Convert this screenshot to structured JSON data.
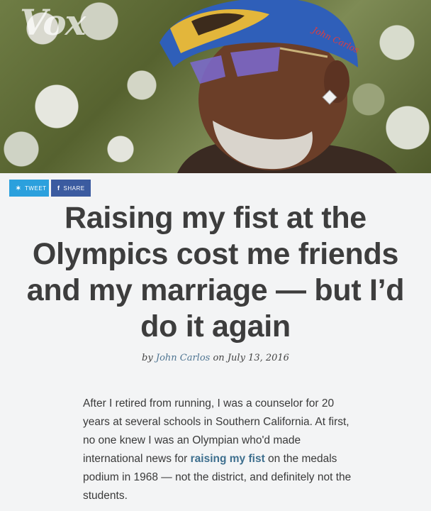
{
  "brand": {
    "logo_text": "Vox"
  },
  "share": {
    "tweet_label": "TWEET",
    "share_label": "SHARE",
    "tweet_icon": "twitter-bird-icon",
    "share_icon": "facebook-f-icon"
  },
  "article": {
    "title": "Raising my fist at the Olympics cost me friends and my marriage — but I’d do it again",
    "by_prefix": "by",
    "author": "John Carlos",
    "on_word": "on",
    "date": "July 13, 2016",
    "body_before_link": "After I retired from running, I was a counselor for 20 years at several schools in Southern California. At first, no one knew I was an Olympian who'd made international news for ",
    "body_link": "raising my fist",
    "body_after_link": " on the medals podium in 1968 — not the district, and definitely not the students."
  },
  "colors": {
    "tweet_button": "#2ba0dd",
    "share_button": "#3b5ba0",
    "link": "#3e6f8e",
    "background": "#f3f4f5"
  }
}
